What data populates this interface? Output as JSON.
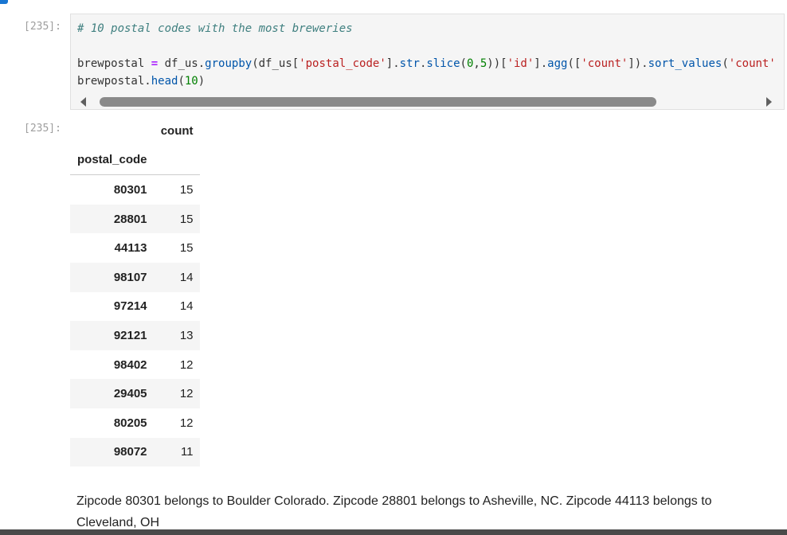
{
  "cell_in": {
    "prompt": "[235]:",
    "code": {
      "comment": "# 10 postal codes with the most breweries",
      "l2_var": "brewpostal",
      "l2_eq": " = ",
      "l2_a": "df_us.",
      "l2_groupby": "groupby",
      "l2_b": "(df_us[",
      "l2_s1": "'postal_code'",
      "l2_c": "].",
      "l2_str": "str",
      "l2_dot": ".",
      "l2_slice": "slice",
      "l2_d": "(",
      "l2_n0": "0",
      "l2_comma": ",",
      "l2_n5": "5",
      "l2_e": "))[",
      "l2_s2": "'id'",
      "l2_f": "].",
      "l2_agg": "agg",
      "l2_g": "([",
      "l2_s3": "'count'",
      "l2_h": "]).",
      "l2_sort": "sort_values",
      "l2_i": "(",
      "l2_s4": "'count'",
      "l3_var": "brewpostal.",
      "l3_head": "head",
      "l3_a": "(",
      "l3_num": "10",
      "l3_b": ")"
    }
  },
  "cell_out": {
    "prompt": "[235]:",
    "table": {
      "column": "count",
      "index_name": "postal_code",
      "rows": [
        {
          "postal_code": "80301",
          "count": "15"
        },
        {
          "postal_code": "28801",
          "count": "15"
        },
        {
          "postal_code": "44113",
          "count": "15"
        },
        {
          "postal_code": "98107",
          "count": "14"
        },
        {
          "postal_code": "97214",
          "count": "14"
        },
        {
          "postal_code": "92121",
          "count": "13"
        },
        {
          "postal_code": "98402",
          "count": "12"
        },
        {
          "postal_code": "29405",
          "count": "12"
        },
        {
          "postal_code": "80205",
          "count": "12"
        },
        {
          "postal_code": "98072",
          "count": "11"
        }
      ]
    }
  },
  "markdown": {
    "text": "Zipcode 80301 belongs to Boulder Colorado. Zipcode 28801 belongs to Asheville, NC. Zipcode 44113 belongs to Cleveland, OH"
  },
  "icons": {
    "scroll_left": "triangle-left",
    "scroll_right": "triangle-right"
  },
  "colors": {
    "accent": "#1976d2",
    "comment": "#408080",
    "string": "#ba2121",
    "number": "#008000",
    "function": "#0055aa",
    "operator": "#aa22ff"
  }
}
